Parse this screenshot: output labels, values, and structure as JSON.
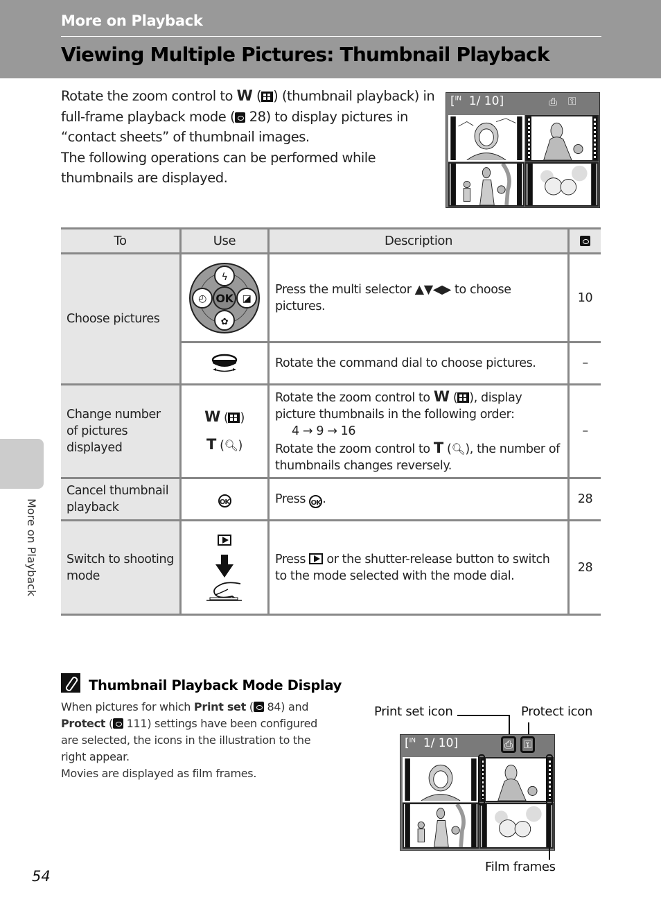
{
  "header": {
    "section": "More on Playback",
    "title": "Viewing Multiple Pictures: Thumbnail Playback"
  },
  "intro": {
    "p1_a": "Rotate the zoom control to ",
    "p1_w": "W",
    "p1_b": " (",
    "p1_c": ") (thumbnail playback) in full-frame playback mode (",
    "p1_ref": "28",
    "p1_d": ") to display pictures in “contact sheets” of thumbnail images.",
    "p2": "The following operations can be performed while thumbnails are displayed."
  },
  "screen": {
    "memory": "IN",
    "counter": "1/   10",
    "print_icon": "print-set-icon",
    "protect_icon": "protect-icon"
  },
  "table": {
    "headers": [
      "To",
      "Use",
      "Description",
      "page-ref-icon"
    ],
    "rows": [
      {
        "to": "Choose pictures",
        "sub": [
          {
            "use": "multi-selector",
            "desc_a": "Press the multi selector ",
            "desc_arrows": "▲▼◀▶",
            "desc_b": " to choose pictures.",
            "page": "10"
          },
          {
            "use": "command-dial",
            "desc": "Rotate the command dial to choose pictures.",
            "page": "–"
          }
        ]
      },
      {
        "to": "Change number of pictures displayed",
        "use_w": "W",
        "use_t": "T",
        "desc_1a": "Rotate the zoom control to ",
        "desc_1w": "W",
        "desc_1b": " (",
        "desc_1c": "), display picture thumbnails in the following order:",
        "desc_order": "4 → 9 → 16",
        "desc_2a": "Rotate the zoom control to ",
        "desc_2t": "T",
        "desc_2b": " (",
        "desc_2c": "), the number of thumbnails changes reversely.",
        "page": "–"
      },
      {
        "to": "Cancel thumbnail playback",
        "use": "ok-button",
        "desc_a": "Press ",
        "desc_b": ".",
        "page": "28"
      },
      {
        "to": "Switch to shooting mode",
        "use": "playback-button / shutter-release",
        "desc_a": "Press ",
        "desc_b": " or the shutter-release button to switch to the mode selected with the mode dial.",
        "page": "28"
      }
    ],
    "ok_label": "OK",
    "selector": {
      "up": "ϟ",
      "left": "◴",
      "right": "◪",
      "down": "✿"
    }
  },
  "note": {
    "title": "Thumbnail Playback Mode Display",
    "b1": "When pictures for which ",
    "b1_bold": "Print set",
    "b1_c": " (",
    "b1_ref": " 84) and ",
    "b2_bold": "Protect",
    "b2_c": " (",
    "b2_ref": " 111) settings have been configured are selected, the icons in the illustration to the right appear.",
    "b3": "Movies are displayed as film frames."
  },
  "callouts": {
    "print": "Print set icon",
    "protect": "Protect icon",
    "film": "Film frames"
  },
  "sidebar": {
    "label": "More on Playback"
  },
  "page_number": "54"
}
